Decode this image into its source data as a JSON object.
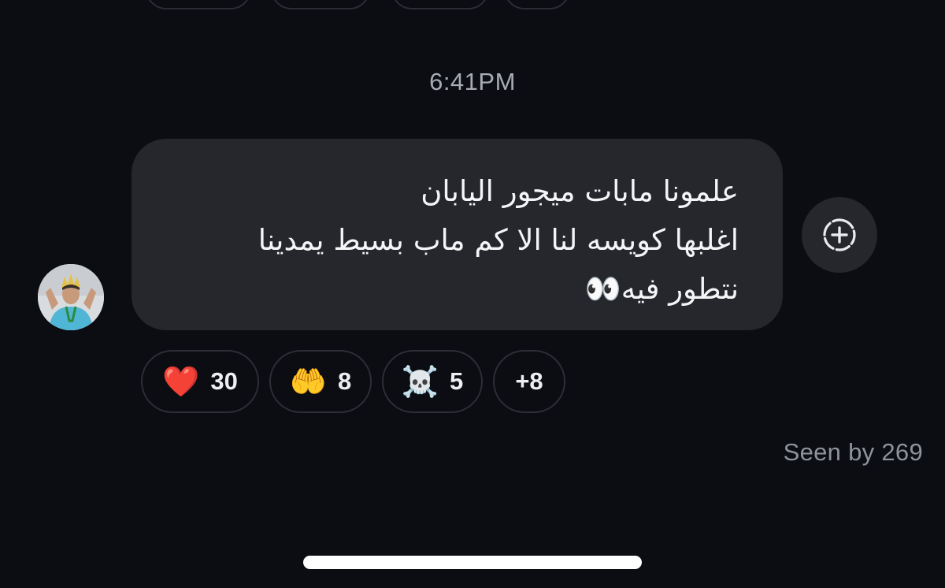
{
  "timestamp": "6:41PM",
  "message": {
    "lines": [
      "علمونا مابات ميجور اليابان",
      "اغلبها كويسه لنا الا كم ماب بسيط يمدينا",
      "نتطور فيه👀"
    ]
  },
  "reactions": [
    {
      "emoji": "❤️",
      "count": "30"
    },
    {
      "emoji": "🤲",
      "count": "8"
    },
    {
      "emoji": "☠️",
      "count": "5"
    },
    {
      "emoji": "",
      "count": "+8"
    }
  ],
  "seen_text": "Seen by 269",
  "icons": {
    "add_reaction": "add-reaction-icon",
    "avatar": "user-avatar"
  },
  "colors": {
    "background": "#0b0d12",
    "bubble": "#25272d",
    "pill_border": "#2c2f36",
    "timestamp": "#a7abb3",
    "seen": "#8e939b"
  }
}
